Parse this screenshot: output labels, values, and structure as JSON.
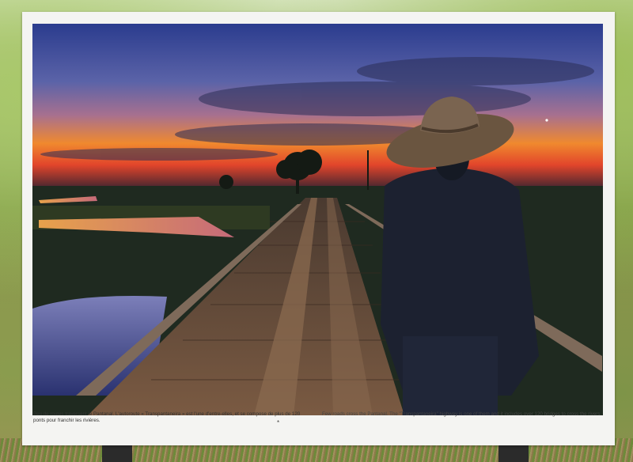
{
  "panel": {
    "caption_fr": "Peu de routes traversent le Pantanal. L'autoroute « Transpantaneira » est l'une d'entre-elles, et se compose de plus de 120 ponts pour franchir les rivières.",
    "caption_en": "Few roads cross the Pantanal. The \"Transpantaneira\" highway is one of them and it includes over 120 bridges to cross the rivers.",
    "center_mark": "*"
  },
  "colors": {
    "sky_top": "#2e3f8f",
    "sky_mid": "#6b6fae",
    "sunset_orange": "#f07a2a",
    "sunset_red": "#d9412a",
    "bridge_wood": "#6a4b35",
    "silhouette": "#1c2130",
    "hat": "#6a5540"
  }
}
